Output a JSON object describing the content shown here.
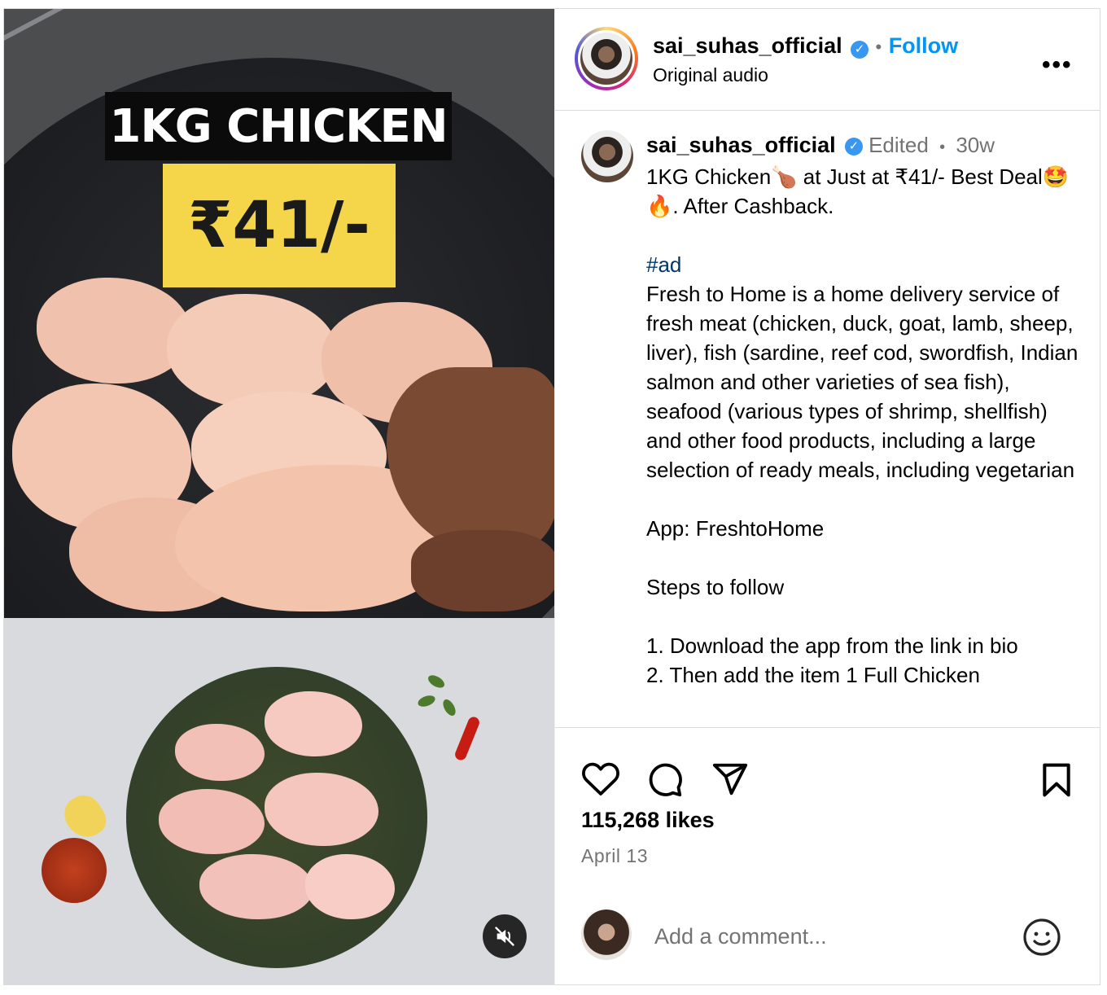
{
  "media": {
    "overlay_title": "1KG CHICKEN",
    "overlay_price": "₹41/-",
    "mute_icon": "speaker-muted-icon"
  },
  "header": {
    "username": "sai_suhas_official",
    "separator": "•",
    "follow_label": "Follow",
    "audio": "Original audio",
    "more_icon": "more-horizontal-icon"
  },
  "caption": {
    "username": "sai_suhas_official",
    "edited": "Edited",
    "separator": "•",
    "age": "30w",
    "headline": "1KG Chicken🍗 at Just at ₹41/- Best Deal🤩🔥. After Cashback.",
    "hashtag": "#ad",
    "body": "Fresh to Home is a home delivery service of fresh meat (chicken, duck, goat, lamb, sheep, liver), fish (sardine, reef cod, swordfish, Indian salmon and other varieties of sea fish), seafood (various types of shrimp, shellfish) and other food products, including a large selection of ready meals, including vegetarian\n\nApp: FreshtoHome\n\nSteps to follow\n\n1. Download the app from the link in bio\n2. Then add the item 1 Full Chicken"
  },
  "actions": {
    "likes": "115,268 likes",
    "date": "April 13",
    "icons": [
      "heart-icon",
      "comment-icon",
      "share-icon",
      "bookmark-icon"
    ]
  },
  "comment": {
    "placeholder": "Add a comment...",
    "emoji_icon": "emoji-icon"
  },
  "colors": {
    "accent": "#0095f6",
    "verified": "#3897f0",
    "muted_text": "#737373",
    "price_badge": "#f5d64a",
    "hashtag": "#00376b"
  }
}
